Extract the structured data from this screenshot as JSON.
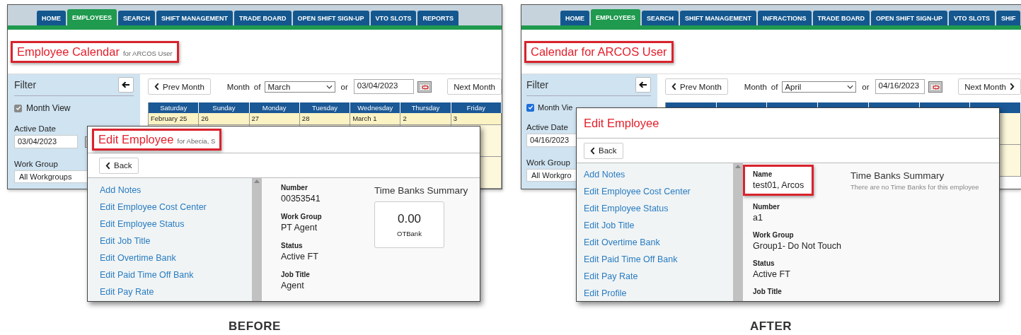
{
  "panels": [
    {
      "caption": "BEFORE",
      "tabs": [
        {
          "label": "HOME",
          "selected": false
        },
        {
          "label": "EMPLOYEES",
          "selected": true
        },
        {
          "label": "SEARCH",
          "selected": false
        },
        {
          "label": "SHIFT MANAGEMENT",
          "selected": false
        },
        {
          "label": "TRADE BOARD",
          "selected": false
        },
        {
          "label": "OPEN SHIFT SIGN-UP",
          "selected": false
        },
        {
          "label": "VTO SLOTS",
          "selected": false
        },
        {
          "label": "REPORTS",
          "selected": false
        }
      ],
      "page_title": {
        "text": "Employee Calendar",
        "subtitle": "for ARCOS User",
        "highlighted": true
      },
      "filter": {
        "title": "Filter",
        "month_view": {
          "label": "Month View",
          "checked": true
        },
        "active_date_label": "Active Date",
        "active_date": "03/04/2023",
        "work_group_label": "Work Group",
        "work_group": "All Workgroups"
      },
      "toolbar": {
        "prev": "Prev Month",
        "month_label": "Month",
        "of": "of",
        "month": "March",
        "or": "or",
        "date": "03/04/2023",
        "next": "Next Month",
        "next_chevron": false
      },
      "calendar": {
        "weekdays": [
          "Saturday",
          "Sunday",
          "Monday",
          "Tuesday",
          "Wednesday",
          "Thursday",
          "Friday"
        ],
        "dates": [
          "February 25",
          "26",
          "27",
          "28",
          "March 1",
          "2",
          "3"
        ]
      },
      "dialog": {
        "title": "Edit Employee",
        "subtitle": "for Abecia, S",
        "highlighted": true,
        "back": "Back",
        "links": [
          "Add Notes",
          "Edit Employee Cost Center",
          "Edit Employee Status",
          "Edit Job Title",
          "Edit Overtime Bank",
          "Edit Paid Time Off Bank",
          "Edit Pay Rate"
        ],
        "fields": [
          {
            "label": "Number",
            "value": "00353541"
          },
          {
            "label": "Work Group",
            "value": "PT Agent"
          },
          {
            "label": "Status",
            "value": "Active FT"
          },
          {
            "label": "Job Title",
            "value": "Agent"
          }
        ],
        "time_banks": {
          "title": "Time Banks Summary",
          "banks": [
            {
              "amount": "0.00",
              "name": "OTBank"
            }
          ]
        }
      }
    },
    {
      "caption": "AFTER",
      "tabs": [
        {
          "label": "HOME",
          "selected": false
        },
        {
          "label": "EMPLOYEES",
          "selected": true
        },
        {
          "label": "SEARCH",
          "selected": false
        },
        {
          "label": "SHIFT MANAGEMENT",
          "selected": false
        },
        {
          "label": "INFRACTIONS",
          "selected": false
        },
        {
          "label": "TRADE BOARD",
          "selected": false
        },
        {
          "label": "OPEN SHIFT SIGN-UP",
          "selected": false
        },
        {
          "label": "VTO SLOTS",
          "selected": false
        },
        {
          "label": "SHIF",
          "selected": false
        }
      ],
      "page_title": {
        "text": "Calendar for ARCOS User",
        "highlighted": true
      },
      "filter": {
        "title": "Filter",
        "month_view": {
          "label": "Month Vie",
          "checked": true
        },
        "active_date_label": "Active Date",
        "active_date": "04/16/2023",
        "work_group_label": "Work Group",
        "work_group": "All Workgro"
      },
      "toolbar": {
        "prev": "Prev Month",
        "month_label": "Month",
        "of": "of",
        "month": "April",
        "or": "or",
        "date": "04/16/2023",
        "next": "Next Month",
        "next_chevron": true
      },
      "dialog": {
        "title": "Edit Employee",
        "back": "Back",
        "links": [
          "Add Notes",
          "Edit Employee Cost Center",
          "Edit Employee Status",
          "Edit Job Title",
          "Edit Overtime Bank",
          "Edit Paid Time Off Bank",
          "Edit Pay Rate",
          "Edit Profile"
        ],
        "fields": [
          {
            "label": "Name",
            "value": "test01, Arcos",
            "highlighted": true
          },
          {
            "label": "Number",
            "value": "a1"
          },
          {
            "label": "Work Group",
            "value": "Group1- Do Not Touch"
          },
          {
            "label": "Status",
            "value": "Active FT"
          },
          {
            "label": "Job Title"
          }
        ],
        "time_banks": {
          "title": "Time Banks Summary",
          "empty_note": "There are no Time Banks for this employee"
        }
      }
    }
  ]
}
